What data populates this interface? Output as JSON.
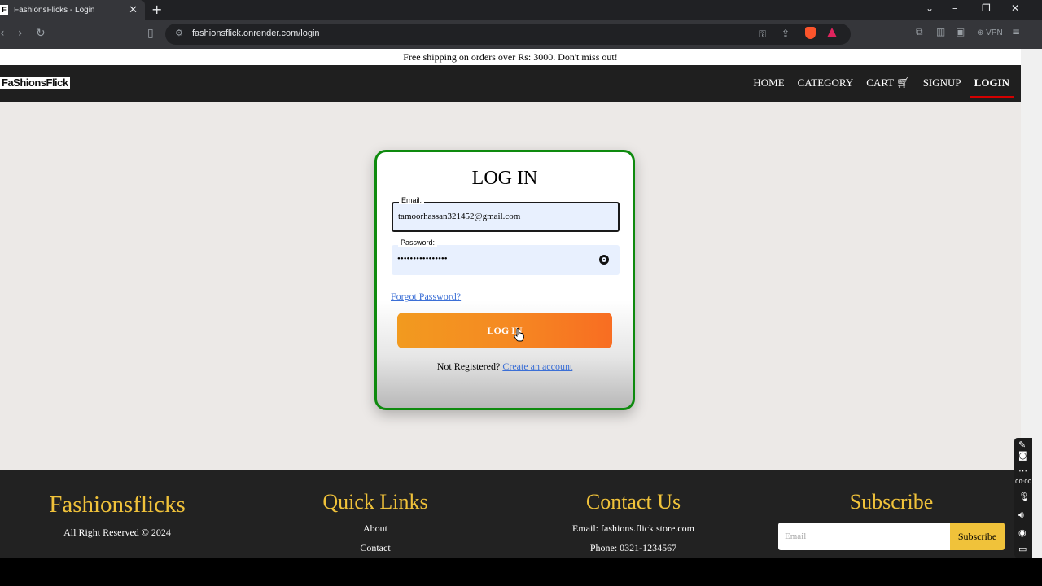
{
  "browser": {
    "tab_title": "FashionsFlicks - Login",
    "tab_favicon": "F",
    "url": "fashionsflick.onrender.com/login",
    "vpn_label": "VPN"
  },
  "announcement": "Free shipping on orders over Rs: 3000. Don't miss out!",
  "nav": {
    "logo": "FaShionsFlick",
    "links": [
      "HOME",
      "CATEGORY",
      "CART",
      "SIGNUP",
      "LOGIN"
    ],
    "active": "LOGIN"
  },
  "login": {
    "title": "LOG IN",
    "email_label": "Email:",
    "email_value": "tamoorhassan321452@gmail.com",
    "password_label": "Password:",
    "password_value": "••••••••••••••••",
    "forgot": "Forgot Password?",
    "button": "LOG IN",
    "not_registered": "Not Registered?",
    "create_account": "Create an account"
  },
  "footer": {
    "brand": "Fashionsflicks",
    "copyright": "All Right Reserved © 2024",
    "quick_links_title": "Quick Links",
    "quick_links": [
      "About",
      "Contact"
    ],
    "contact_title": "Contact Us",
    "contact_email": "Email: fashions.flick.store.com",
    "contact_phone": "Phone: 0321-1234567",
    "subscribe_title": "Subscribe",
    "subscribe_placeholder": "Email",
    "subscribe_button": "Subscribe"
  },
  "colors": {
    "card_border": "#0e8a0e",
    "button_start": "#f29a1f",
    "button_end": "#f86d22",
    "footer_heading": "#f0c23a",
    "link": "#3b6fd6"
  },
  "overlay": {
    "timer": "00:00"
  }
}
